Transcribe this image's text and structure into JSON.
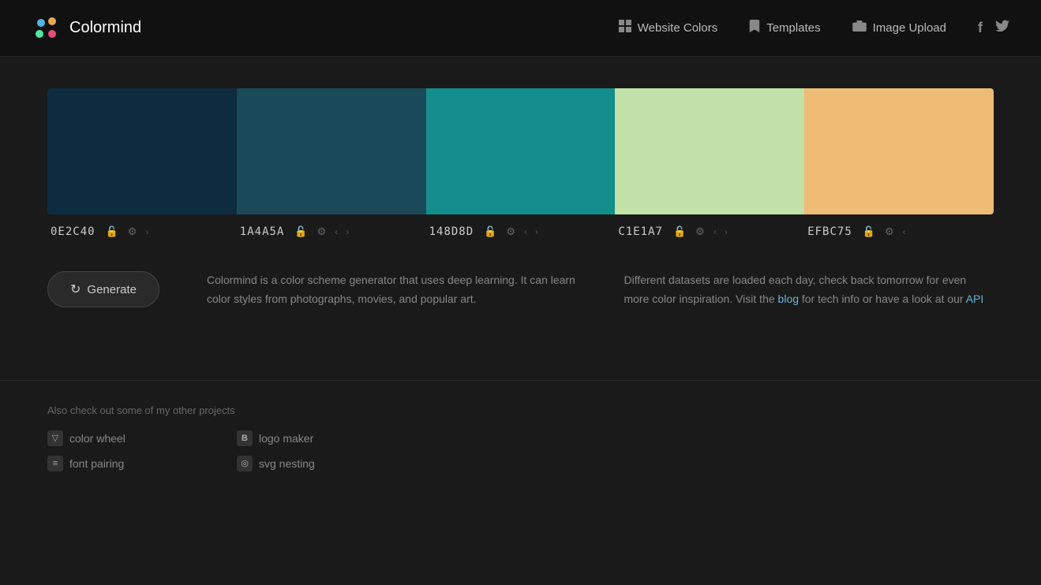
{
  "nav": {
    "logo_text": "Colormind",
    "links": [
      {
        "id": "website-colors",
        "icon": "grid",
        "label": "Website Colors"
      },
      {
        "id": "templates",
        "icon": "bookmark",
        "label": "Templates"
      },
      {
        "id": "image-upload",
        "icon": "camera",
        "label": "Image Upload"
      }
    ],
    "social": [
      {
        "id": "facebook",
        "icon": "f"
      },
      {
        "id": "twitter",
        "icon": "t"
      }
    ]
  },
  "palette": {
    "swatches": [
      {
        "hex": "0E2C40",
        "color": "#0E2C40",
        "locked": false
      },
      {
        "hex": "1A4A5A",
        "color": "#1A4A5A",
        "locked": false
      },
      {
        "hex": "148D8D",
        "color": "#148D8D",
        "locked": false
      },
      {
        "hex": "C1E1A7",
        "color": "#C1E1A7",
        "locked": false
      },
      {
        "hex": "EFBC75",
        "color": "#EFBC75",
        "locked": false
      }
    ]
  },
  "generate": {
    "button_label": "Generate",
    "description_left": "Colormind is a color scheme generator that uses deep learning. It can learn color styles from photographs, movies, and popular art.",
    "description_right_before": "Different datasets are loaded each day, check back tomorrow for even more color inspiration. Visit the",
    "blog_label": "blog",
    "blog_url": "#",
    "description_mid": " for tech info or have a look at our ",
    "api_label": "API",
    "api_url": "#"
  },
  "footer": {
    "title": "Also check out some of my other projects",
    "links": [
      {
        "id": "color-wheel",
        "icon": "▽",
        "label": "color wheel"
      },
      {
        "id": "logo-maker",
        "icon": "B",
        "label": "logo maker"
      },
      {
        "id": "font-pairing",
        "icon": "≡",
        "label": "font pairing"
      },
      {
        "id": "svg-nesting",
        "icon": "◎",
        "label": "svg nesting"
      }
    ]
  }
}
